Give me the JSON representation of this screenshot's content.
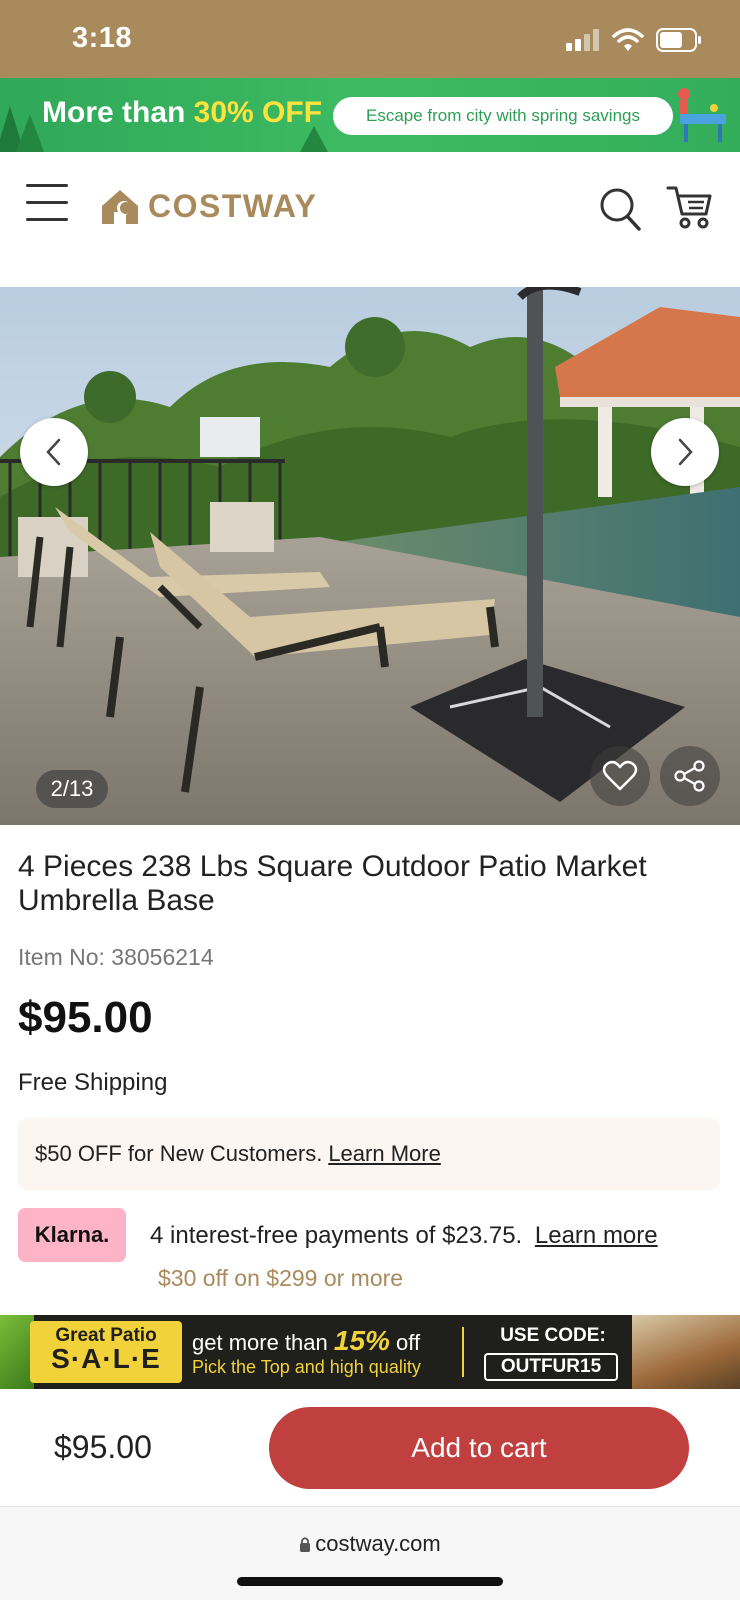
{
  "status_bar": {
    "time": "3:18"
  },
  "promo_top": {
    "text_prefix": "More than ",
    "text_highlight": "30% OFF",
    "pill_text": "Escape from city with spring savings"
  },
  "header": {
    "logo_text": "COSTWAY"
  },
  "gallery": {
    "counter": "2/13"
  },
  "product": {
    "title": "4 Pieces 238 Lbs Square Outdoor Patio Market Umbrella Base",
    "item_no": "Item No: 38056214",
    "price": "$95.00",
    "shipping": "Free Shipping",
    "coupon_text": "$50 OFF for New Customers.",
    "coupon_link": "Learn More"
  },
  "klarna": {
    "badge": "Klarna.",
    "text": "4 interest-free payments of $23.75.",
    "link": "Learn more",
    "offer": "$30 off on $299 or more"
  },
  "sale_banner": {
    "line1": "Great Patio",
    "line2": "S·A·L·E",
    "mid_prefix": "get more than ",
    "mid_pct": "15%",
    "mid_suffix": " off",
    "mid_line2": "Pick the Top and high quality",
    "code_label": "USE CODE:",
    "code": "OUTFUR15"
  },
  "cart_bar": {
    "price": "$95.00",
    "button_label": "Add to cart"
  },
  "browser": {
    "url": "costway.com"
  },
  "colors": {
    "brand": "#a98a5c",
    "cta": "#c03f3f",
    "klarna": "#ffb3c7",
    "promo_green": "#3dbb62"
  }
}
